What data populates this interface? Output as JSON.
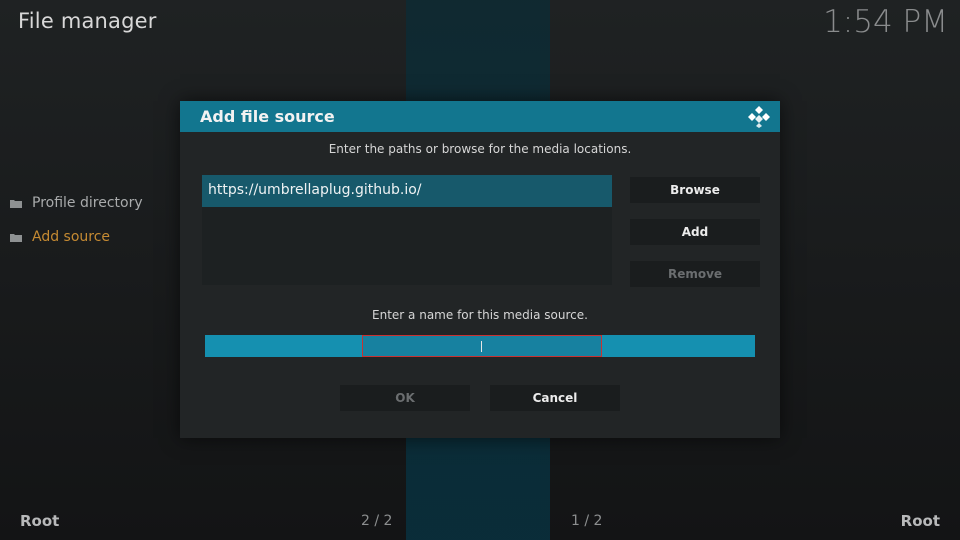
{
  "header": {
    "title": "File manager",
    "clock": "1:54 PM"
  },
  "sidebar": {
    "items": [
      {
        "label": "Profile directory",
        "icon": "folder-icon"
      },
      {
        "label": "Add source",
        "icon": "folder-icon"
      }
    ]
  },
  "footer": {
    "left_label": "Root",
    "left_page": "2 / 2",
    "right_page": "1 / 2",
    "right_label": "Root"
  },
  "dialog": {
    "title": "Add file source",
    "logo_icon": "kodi-logo-icon",
    "paths_instruction": "Enter the paths or browse for the media locations.",
    "paths": [
      "https://umbrellaplug.github.io/"
    ],
    "browse_label": "Browse",
    "add_label": "Add",
    "remove_label": "Remove",
    "name_instruction": "Enter a name for this media source.",
    "name_value": "",
    "ok_label": "OK",
    "cancel_label": "Cancel"
  },
  "colors": {
    "accent": "#12768f",
    "active_item": "#c58a32",
    "input_border": "#c83232"
  }
}
